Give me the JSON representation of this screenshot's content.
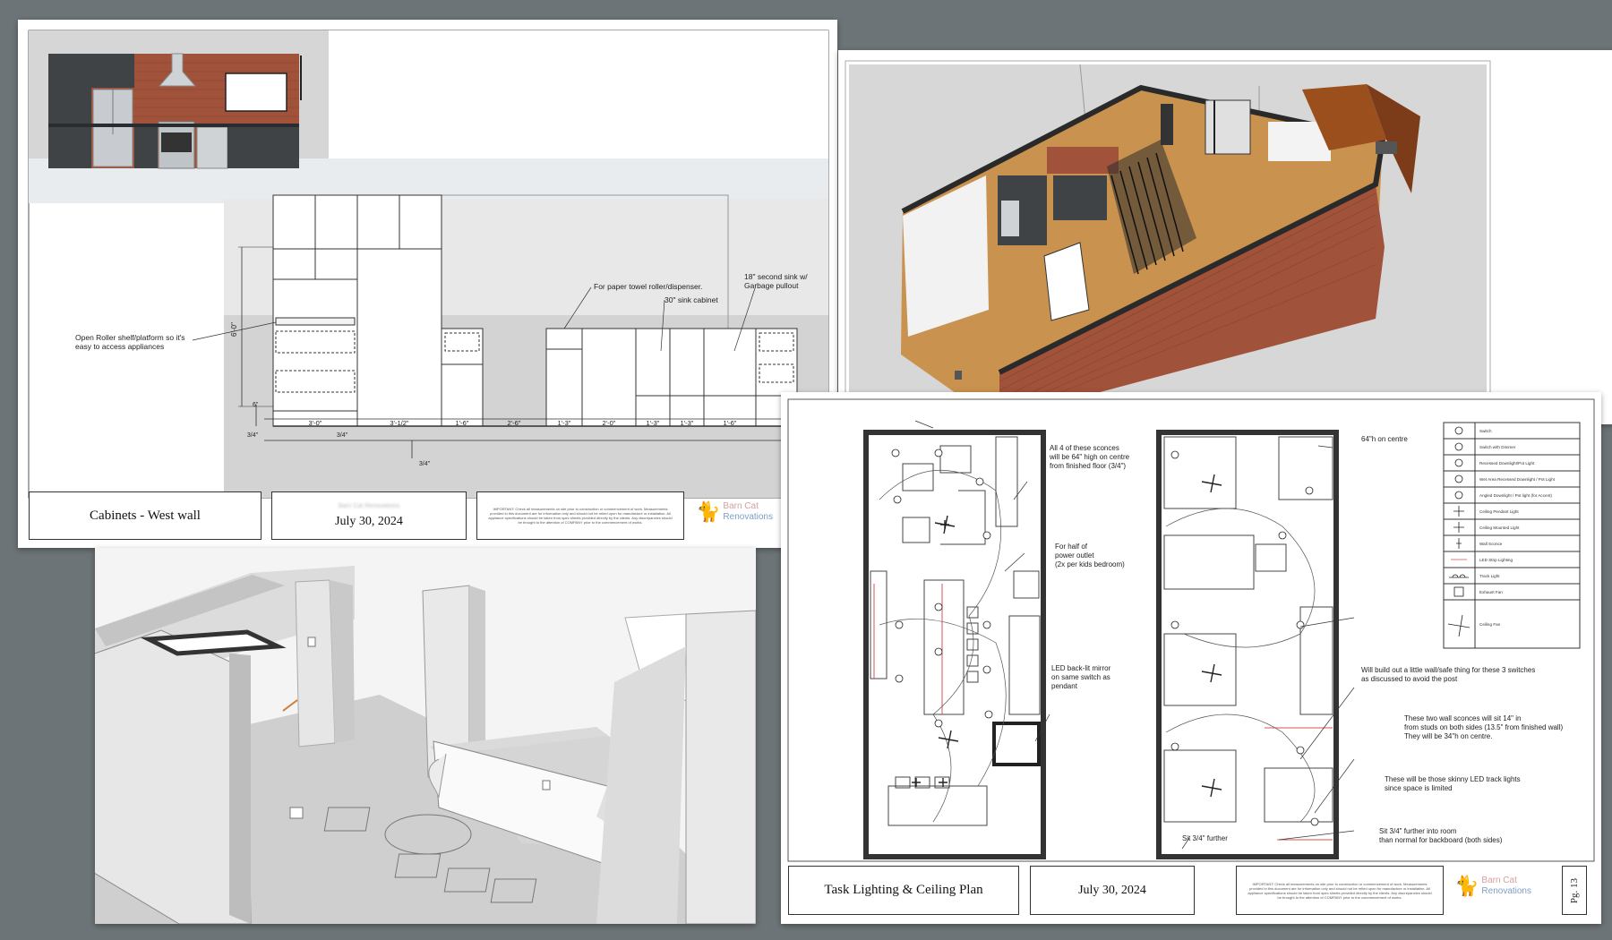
{
  "cabinets_sheet": {
    "title": "Cabinets - West wall",
    "date": "July 30, 2024",
    "blurred_line": "Barn Cat Renovations",
    "disclaimer": "IMPORTANT: Check all measurements on site prior to construction or commencement of work. Measurements provided in this document are for information only and should not be relied upon for manufacture or installation. All appliance specifications should be taken from spec sheets provided directly by the clients. Any discrepancies should be brought to the attention of COMPANY prior to the commencement of works.",
    "logo": {
      "line1": "Barn Cat",
      "line2": "Renovations"
    },
    "annotations": {
      "roller_shelf": "Open Roller shelf/platform so it's\neasy to access appliances",
      "paper_towel": "For paper towel roller/dispenser.",
      "sink_cabinet": "30\" sink cabinet",
      "second_sink": "18\" second sink w/\nGarbage pullout"
    },
    "dimensions": {
      "height": "6'-0\"",
      "plinth": "6\"",
      "gap_a": "3/4\"",
      "gap_b": "3/4\"",
      "gap_c": "3/4\"",
      "runs": [
        "3'-0\"",
        "3'-1/2\"",
        "1'-6\"",
        "2'-6\"",
        "1'-3\"",
        "2'-0\"",
        "1'-3\"",
        "1'-3\"",
        "1'-6\""
      ]
    }
  },
  "lighting_sheet": {
    "title": "Task Lighting & Ceiling Plan",
    "date": "July 30, 2024",
    "page_label": "Pg. 13",
    "disclaimer": "IMPORTANT: Check all measurements on site prior to construction or commencement of work. Measurements provided in this document are for information only and should not be relied upon for manufacture or installation. All appliance specifications should be taken from spec sheets provided directly by the clients. Any discrepancies should be brought to the attention of COMPANY prior to the commencement of works.",
    "logo": {
      "line1": "Barn Cat",
      "line2": "Renovations"
    },
    "notes": {
      "sconces": "All 4 of these sconces\nwill be 64\" high on centre\nfrom finished floor (3/4\")",
      "outlet": "For half of\npower outlet\n(2x per kids bedroom)",
      "mirror": "LED back-lit mirror\non same switch as\npendant",
      "on_centre": "64\"h on centre",
      "switches": "Will build out a little wall/safe thing for these 3 switches\nas discussed to avoid the post",
      "wall_sconces": "These two wall sconces will sit 14\" in\nfrom studs on both sides (13.5\" from finished wall)\nThey will be 34\"h on centre.",
      "track": "These will be those skinny LED track lights\nsince space is limited",
      "further_room": "Sit 3/4\" further into room\nthan normal for backboard (both sides)",
      "further": "Sit 3/4\" further"
    },
    "legend": [
      "Switch",
      "Switch with Dimmer",
      "Recessed Downlight/Pot Light",
      "Wet Area Recessed Downlight / Pot Light",
      "Angled Downlight / Pot light (for Accent)",
      "Ceiling Pendant Light",
      "Ceiling Mounted Light",
      "Wall Sconce",
      "LED Strip Lighting",
      "Track Light",
      "Exhaust Fan",
      "Ceiling Fan"
    ]
  },
  "colors": {
    "background": "#6c7477",
    "brick": "#a0523a",
    "wood_floor": "#c9924f",
    "cabinet_dark": "#3f4346",
    "accent_red": "#d9534f"
  }
}
